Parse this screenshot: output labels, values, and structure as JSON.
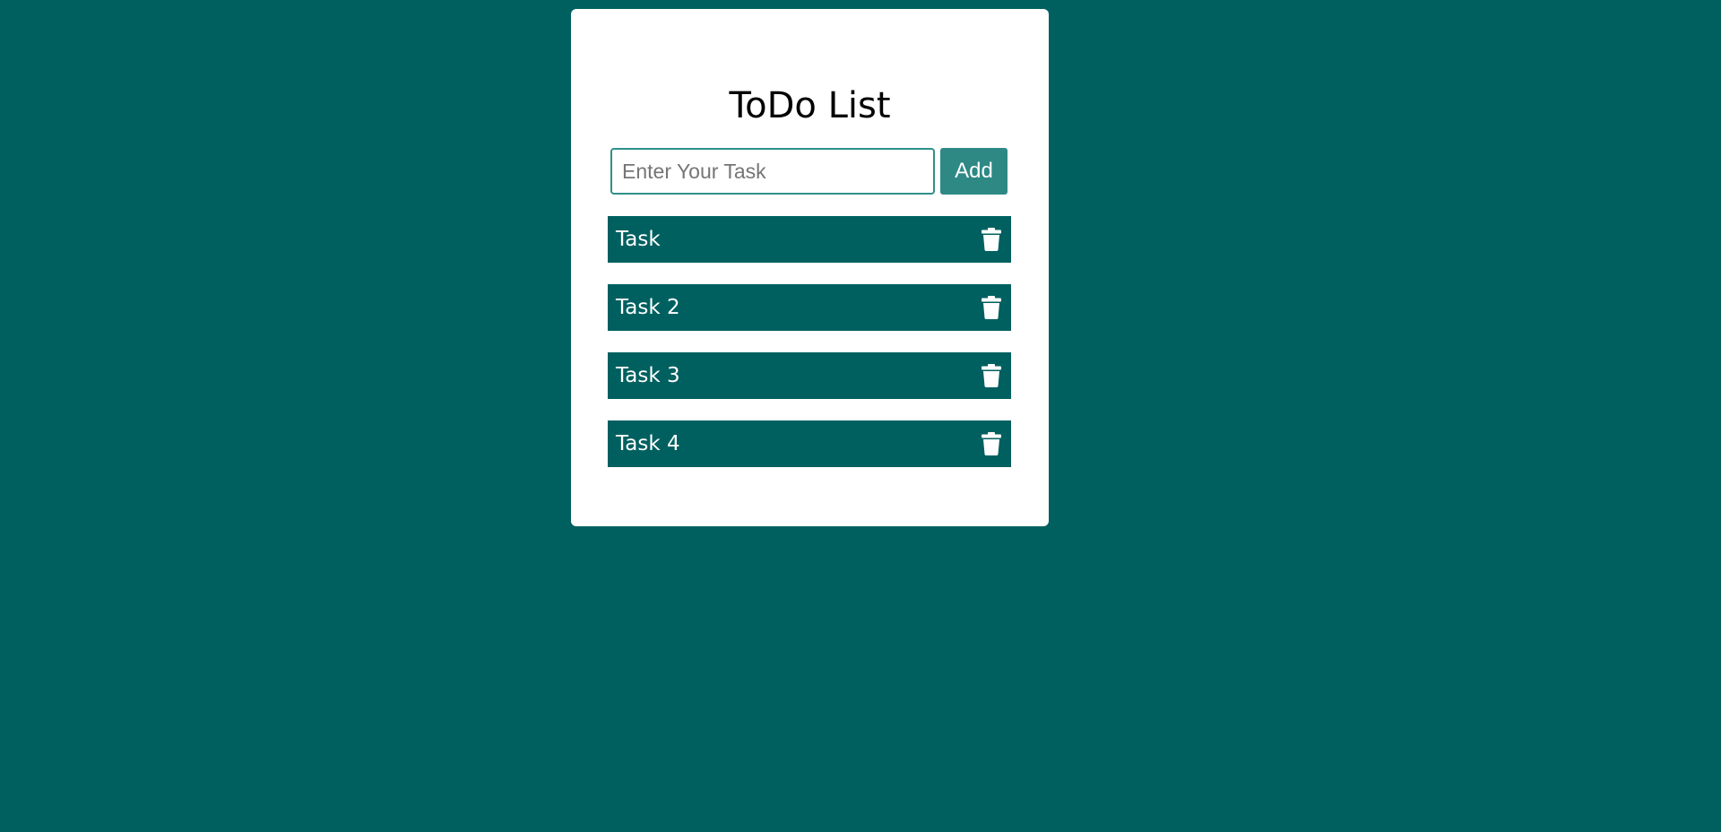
{
  "app": {
    "title": "ToDo List"
  },
  "entry": {
    "placeholder": "Enter Your Task",
    "value": "",
    "add_label": "Add"
  },
  "tasks": [
    {
      "label": "Task",
      "icon": "trash-icon"
    },
    {
      "label": "Task 2",
      "icon": "trash-icon"
    },
    {
      "label": "Task 3",
      "icon": "trash-icon"
    },
    {
      "label": "Task 4",
      "icon": "trash-icon"
    }
  ],
  "colors": {
    "background": "#006060",
    "card": "#ffffff",
    "accent": "#2e8985",
    "task_row": "#006060",
    "task_text": "#ffffff"
  }
}
